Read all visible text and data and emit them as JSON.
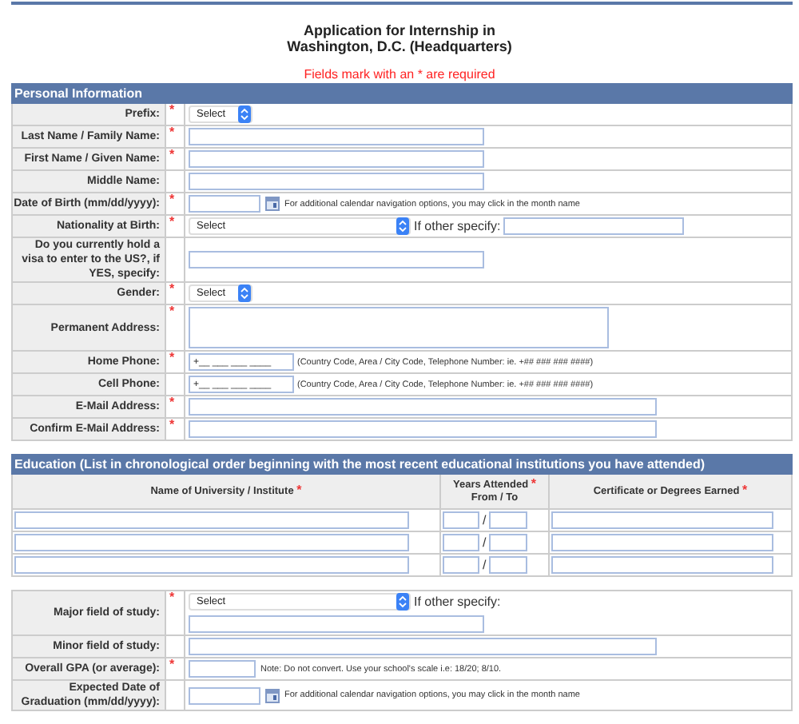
{
  "title_lines": [
    "Application for Internship in",
    "Washington, D.C. (Headquarters)"
  ],
  "required_note": "Fields mark with an * are required",
  "personal": {
    "header": "Personal Information",
    "fields": [
      {
        "label": "Prefix:",
        "mark": "*",
        "kind": "select",
        "value": "Select"
      },
      {
        "label": "Last Name / Family Name:",
        "mark": "*",
        "kind": "text"
      },
      {
        "label": "First Name / Given Name:",
        "mark": "*",
        "kind": "text"
      },
      {
        "label": "Middle Name:",
        "kind": "text"
      },
      {
        "label": "Date of Birth (mm/dd/yyyy):",
        "mark": "*",
        "kind": "date",
        "hint": "For additional calendar navigation options, you may click in the month name"
      },
      {
        "label": "Nationality at Birth:",
        "mark": "*",
        "kind": "select_other",
        "value": "Select",
        "other_label": "If other specify:"
      },
      {
        "label": "Do you currently hold a visa to enter to the US?, if YES, specify:",
        "kind": "text"
      },
      {
        "label": "Gender:",
        "mark": "*",
        "kind": "select",
        "value": "Select"
      },
      {
        "label": "Permanent Address:",
        "mark": "*",
        "kind": "textarea"
      },
      {
        "label": "Home Phone:",
        "mark": "*",
        "kind": "phone",
        "value": "+__ ___ ___ ____",
        "hint": "(Country Code, Area / City Code, Telephone Number: ie. +## ### ### ####)"
      },
      {
        "label": "Cell Phone:",
        "kind": "phone",
        "value": "+__ ___ ___ ____",
        "hint": "(Country Code, Area / City Code, Telephone Number: ie. +## ### ### ####)"
      },
      {
        "label": "E-Mail Address:",
        "mark": "*",
        "kind": "long_text"
      },
      {
        "label": "Confirm E-Mail Address:",
        "mark": "*",
        "kind": "long_text"
      }
    ]
  },
  "education": {
    "header": "Education (List in chronological order beginning with the most recent educational institutions you have attended)",
    "columns": [
      {
        "label": "Name of University / Institute",
        "mark": "*"
      },
      {
        "label": "Years Attended",
        "mark": "*",
        "sublabel": "From / To"
      },
      {
        "label": "Certificate or Degrees Earned",
        "mark": "*"
      }
    ],
    "rows": [
      {
        "separator": "/"
      },
      {
        "separator": "/"
      },
      {
        "separator": "/"
      }
    ]
  },
  "study": {
    "fields": [
      {
        "label": "Major field of study:",
        "mark": "*",
        "kind": "select_other_below",
        "value": "Select",
        "other_label": "If other specify:"
      },
      {
        "label": "Minor field of study:",
        "kind": "long_text"
      },
      {
        "label": "Overall GPA (or average):",
        "mark": "*",
        "kind": "note_text",
        "hint": "Note: Do not convert. Use your school's scale i.e: 18/20; 8/10."
      },
      {
        "label": "Expected Date of Graduation (mm/dd/yyyy):",
        "kind": "date",
        "hint": "For additional calendar navigation options, you may click in the month name"
      }
    ]
  }
}
